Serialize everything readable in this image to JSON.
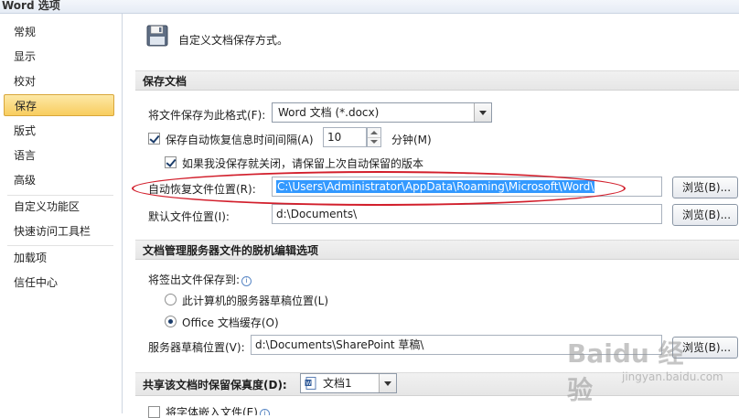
{
  "window": {
    "title": "Word 选项"
  },
  "sidebar": {
    "items": [
      {
        "label": "常规"
      },
      {
        "label": "显示"
      },
      {
        "label": "校对"
      },
      {
        "label": "保存",
        "active": true
      },
      {
        "label": "版式"
      },
      {
        "label": "语言"
      },
      {
        "label": "高级"
      },
      {
        "label": "自定义功能区"
      },
      {
        "label": "快速访问工具栏"
      },
      {
        "label": "加载项"
      },
      {
        "label": "信任中心"
      }
    ]
  },
  "header": {
    "text": "自定义文档保存方式。",
    "icon": "save-icon"
  },
  "save_docs": {
    "title": "保存文档",
    "format_label": "将文件保存为此格式(F):",
    "format_value": "Word 文档 (*.docx)",
    "autorecover_label": "保存自动恢复信息时间间隔(A)",
    "autorecover_checked": true,
    "autorecover_minutes": "10",
    "minutes_label": "分钟(M)",
    "keep_last_label": "如果我没保存就关闭，请保留上次自动保留的版本",
    "keep_last_checked": true,
    "autorecover_location_label": "自动恢复文件位置(R):",
    "autorecover_location_value": "C:\\Users\\Administrator\\AppData\\Roaming\\Microsoft\\Word\\",
    "default_location_label": "默认文件位置(I):",
    "default_location_value": "d:\\Documents\\",
    "browse_label": "浏览(B)..."
  },
  "offline": {
    "title": "文档管理服务器文件的脱机编辑选项",
    "checkout_label": "将签出文件保存到:",
    "option_local": "此计算机的服务器草稿位置(L)",
    "option_cache": "Office 文档缓存(O)",
    "selected_option": "Office 文档缓存(O)",
    "drafts_label": "服务器草稿位置(V):",
    "drafts_value": "d:\\Documents\\SharePoint 草稿\\",
    "browse_label": "浏览(B)..."
  },
  "fidelity": {
    "title": "共享该文档时保留保真度(D):",
    "doc_value": "文档1",
    "embed_label": "将字体嵌入文件(E)"
  },
  "watermark": {
    "text": "Baidu 经验",
    "url": "jingyan.baidu.com"
  },
  "colors": {
    "highlight": "#f8cd5f",
    "annotation": "#d21f2c",
    "selection": "#3399ff"
  }
}
